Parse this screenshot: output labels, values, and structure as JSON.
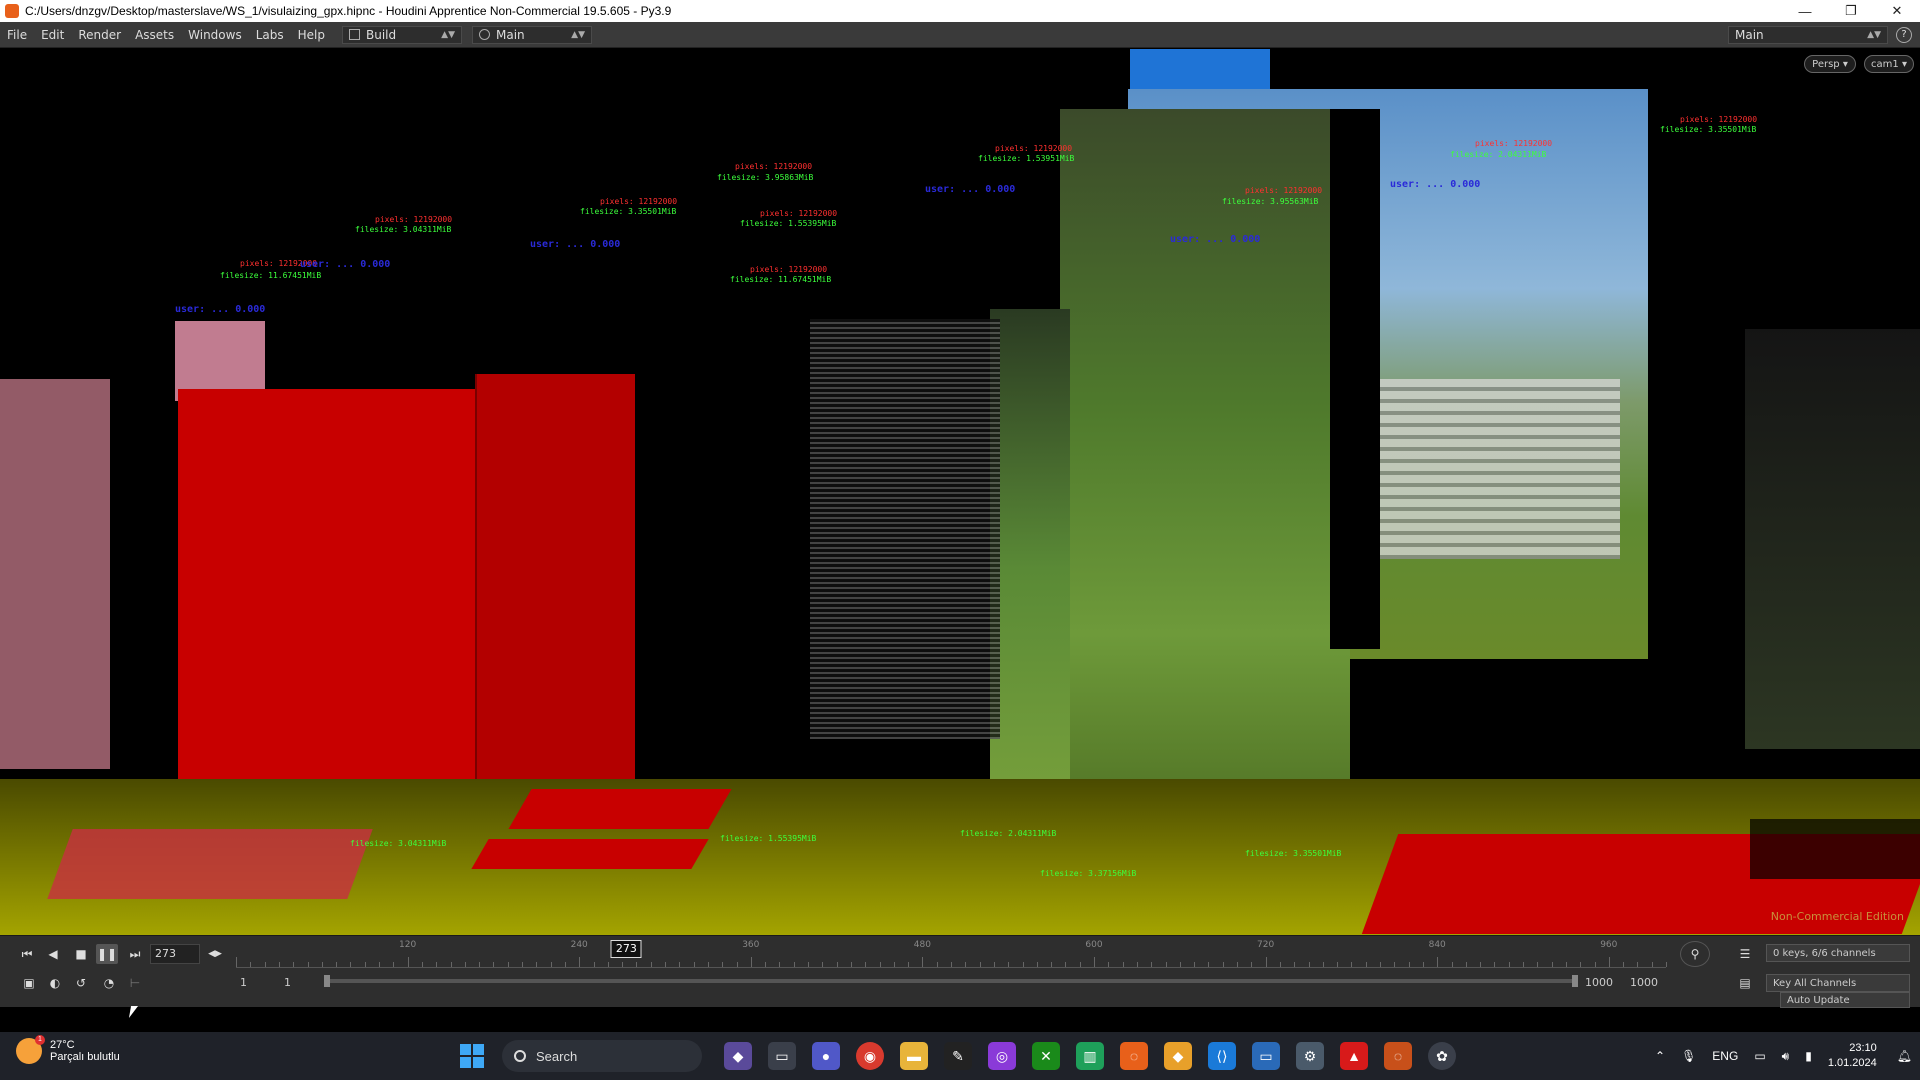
{
  "window": {
    "title": "C:/Users/dnzgv/Desktop/masterslave/WS_1/visulaizing_gpx.hipnc - Houdini Apprentice Non-Commercial 19.5.605 - Py3.9",
    "minimize": "—",
    "maximize": "❐",
    "close": "✕"
  },
  "menubar": {
    "items": [
      "File",
      "Edit",
      "Render",
      "Assets",
      "Windows",
      "Labs",
      "Help"
    ],
    "desktop1": "Build",
    "desktop2": "Main",
    "desktop_right": "Main",
    "help_icon": "?"
  },
  "viewport": {
    "persp_label": "Persp ▾",
    "cam_label": "cam1 ▾",
    "watermark": "Non-Commercial Edition",
    "red_labels": [
      "pixels: 12192000",
      "pixels: 12192000",
      "pixels: 12192000",
      "pixels: 12192000",
      "pixels: 12192000",
      "pixels: 12192000",
      "pixels: 12192000",
      "pixels: 12192000",
      "pixels: 12192000",
      "pixels: 12192000"
    ],
    "green_labels": [
      "filesize: 3.04311MiB",
      "filesize: 3.95863MiB",
      "filesize: 3.35501MiB",
      "filesize: 1.55395MiB",
      "filesize: 11.67451MiB",
      "filesize: 2.04311MiB",
      "filesize: 1.53951MiB",
      "filesize: 3.95563MiB",
      "filesize: 2.04311MiB",
      "filesize: 3.35501MiB",
      "filesize: 1.55395MiB",
      "filesize: 3.37156MiB"
    ],
    "blue_labels": [
      "user: ... 0.000",
      "user: ... 0.000",
      "user: ... 0.000",
      "user: ... 0.000",
      "user: ... 0.000",
      "user: ... 0.000"
    ]
  },
  "timeline": {
    "current_frame": "273",
    "playhead": "273",
    "tick_labels": [
      "120",
      "240",
      "360",
      "480",
      "600",
      "720",
      "840",
      "960"
    ],
    "range_start": "1",
    "range_start2": "1",
    "range_end": "1000",
    "range_end2": "1000",
    "keys_info": "0 keys, 6/6 channels",
    "key_all": "Key All Channels",
    "auto_update": "Auto Update"
  },
  "taskbar": {
    "temperature": "27°C",
    "weather": "Parçalı bulutlu",
    "search": "Search",
    "lang": "ENG",
    "time": "23:10",
    "date": "1.01.2024",
    "weather_badge": "1"
  },
  "colors": {
    "red_block": "#c80000",
    "yellow_ground": "#a6a600",
    "accent_blue": "#1f74d6"
  }
}
